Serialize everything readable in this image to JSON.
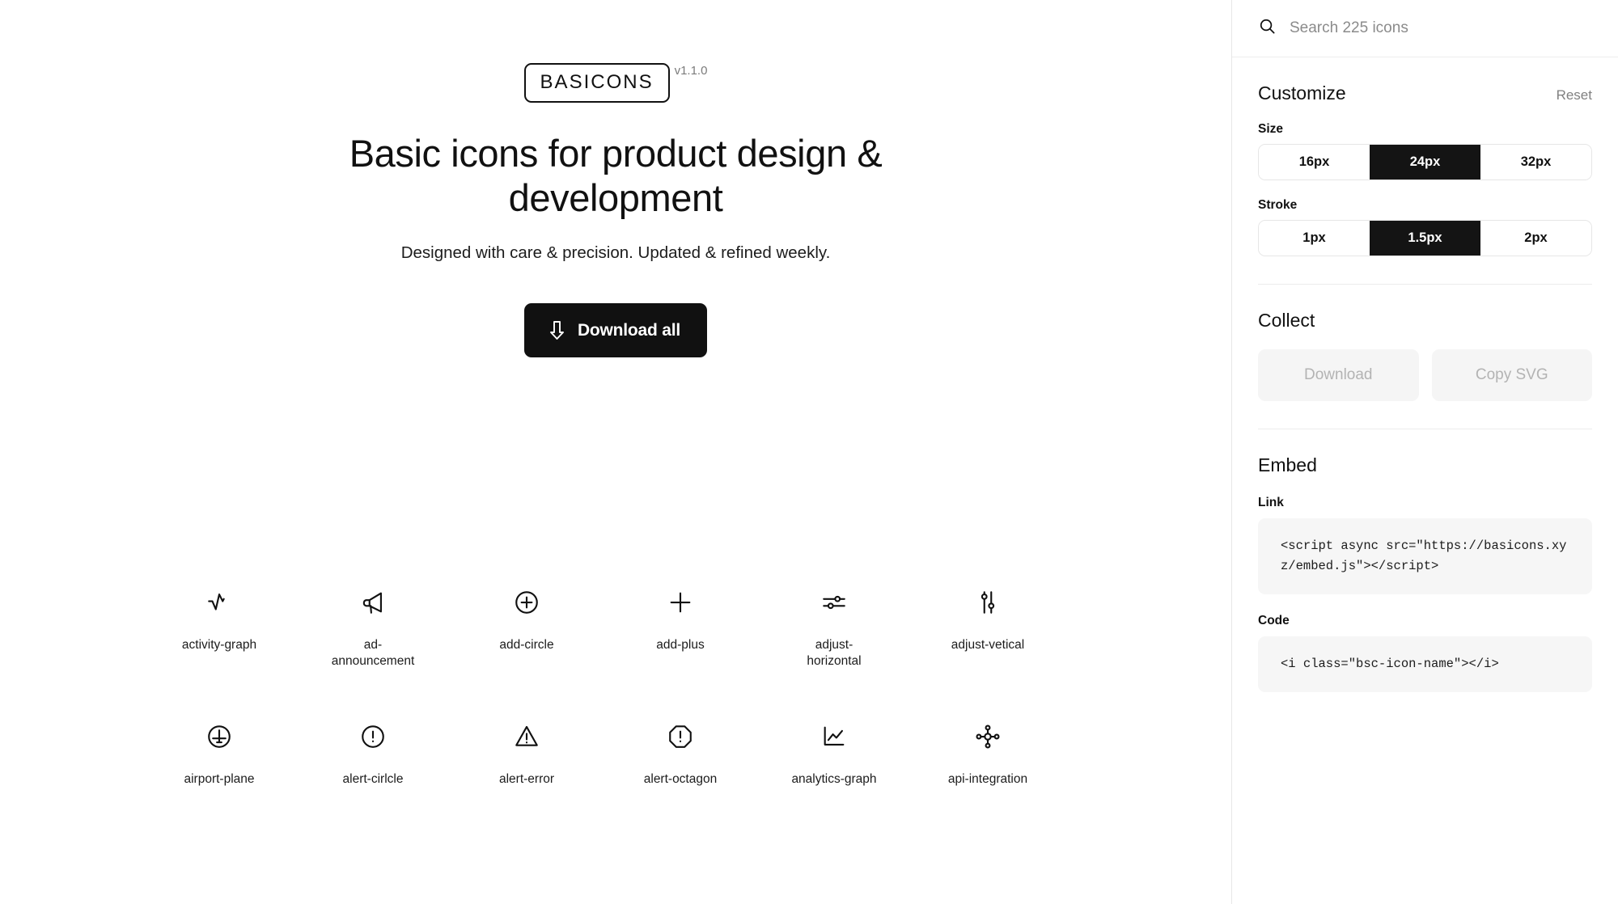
{
  "hero": {
    "logo_text": "BASICONS",
    "version": "v1.1.0",
    "headline": "Basic icons for product design & development",
    "subtitle": "Designed with care & precision. Updated & refined weekly.",
    "download_all_label": "Download all",
    "download_icon": "download-arrow-icon"
  },
  "icons": [
    {
      "name": "activity-graph",
      "glyph": "activity-graph-icon"
    },
    {
      "name": "ad-announcement",
      "glyph": "megaphone-icon"
    },
    {
      "name": "add-circle",
      "glyph": "plus-circle-icon"
    },
    {
      "name": "add-plus",
      "glyph": "plus-icon"
    },
    {
      "name": "adjust-horizontal",
      "glyph": "sliders-horizontal-icon"
    },
    {
      "name": "adjust-vetical",
      "glyph": "sliders-vertical-icon"
    },
    {
      "name": "airport-plane",
      "glyph": "plane-circle-icon"
    },
    {
      "name": "alert-cirlcle",
      "glyph": "alert-circle-icon"
    },
    {
      "name": "alert-error",
      "glyph": "alert-triangle-icon"
    },
    {
      "name": "alert-octagon",
      "glyph": "alert-octagon-icon"
    },
    {
      "name": "analytics-graph",
      "glyph": "analytics-chart-icon"
    },
    {
      "name": "api-integration",
      "glyph": "nodes-network-icon"
    }
  ],
  "sidebar": {
    "search": {
      "placeholder": "Search 225 icons",
      "value": "",
      "icon": "search-icon"
    },
    "customize": {
      "title": "Customize",
      "reset_label": "Reset",
      "size": {
        "label": "Size",
        "options": [
          "16px",
          "24px",
          "32px"
        ],
        "selected": "24px"
      },
      "stroke": {
        "label": "Stroke",
        "options": [
          "1px",
          "1.5px",
          "2px"
        ],
        "selected": "1.5px"
      }
    },
    "collect": {
      "title": "Collect",
      "download_label": "Download",
      "copy_svg_label": "Copy SVG",
      "disabled": true
    },
    "embed": {
      "title": "Embed",
      "link_label": "Link",
      "link_code": "<script async src=\"https://basicons.xyz/embed.js\"></script>",
      "code_label": "Code",
      "code_snippet": "<i class=\"bsc-icon-name\"></i>"
    }
  },
  "colors": {
    "accent": "#141414",
    "text": "#111111",
    "muted": "#8b8b8b",
    "panel_border": "#e7e7e7",
    "code_bg": "#f6f6f6",
    "ghost_bg": "#f5f5f5"
  }
}
